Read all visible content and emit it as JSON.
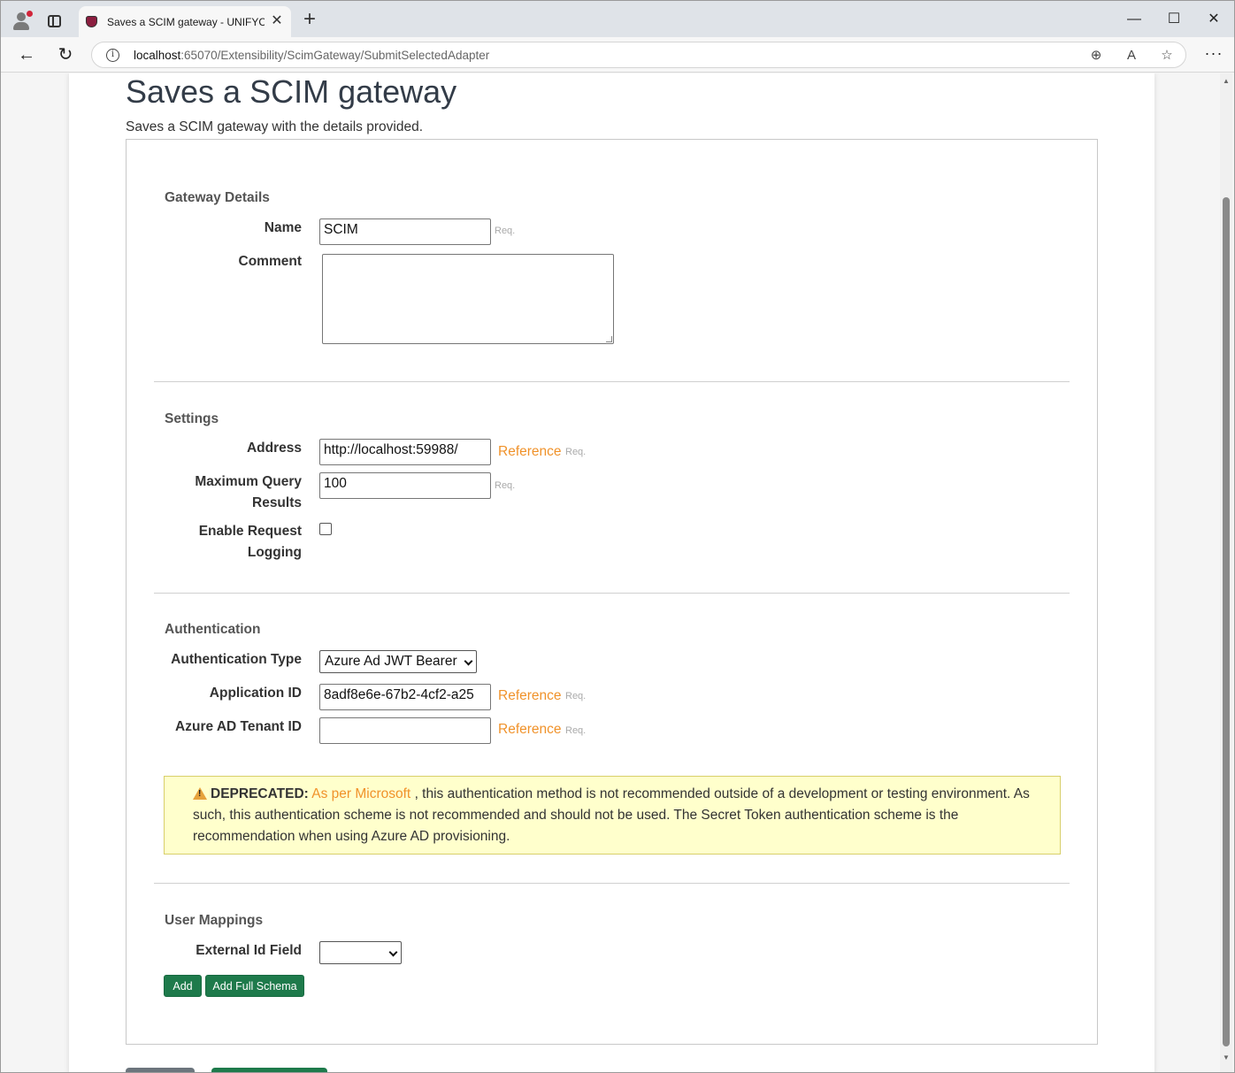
{
  "browser": {
    "tab_title": "Saves a SCIM gateway - UNIFYConnect",
    "tab_close": "✕",
    "new_tab": "+",
    "url_host": "localhost",
    "url_rest": ":65070/Extensibility/ScimGateway/SubmitSelectedAdapter",
    "minimize": "—",
    "maximize": "☐",
    "close": "✕",
    "back": "←",
    "refresh": "↻",
    "menu": "···"
  },
  "page": {
    "title": "Saves a SCIM gateway",
    "subtitle": "Saves a SCIM gateway with the details provided."
  },
  "gateway_details": {
    "section_title": "Gateway Details",
    "name_label": "Name",
    "name_value": "SCIM",
    "name_req": "Req.",
    "comment_label": "Comment"
  },
  "settings": {
    "section_title": "Settings",
    "address_label": "Address",
    "address_value": "http://localhost:59988/",
    "address_ref": "Reference",
    "address_req": "Req.",
    "max_query_label_1": "Maximum Query",
    "max_query_label_2": "Results",
    "max_query_value": "100",
    "max_query_req": "Req.",
    "logging_label_1": "Enable Request",
    "logging_label_2": "Logging",
    "logging_enabled": false
  },
  "authentication": {
    "section_title": "Authentication",
    "auth_type_label": "Authentication Type",
    "auth_type_value": "Azure Ad JWT Bearer",
    "app_id_label": "Application ID",
    "app_id_value": "8adf8e6e-67b2-4cf2-a25",
    "app_id_ref": "Reference",
    "app_id_req": "Req.",
    "tenant_label": "Azure AD Tenant ID",
    "tenant_value": "",
    "tenant_ref": "Reference",
    "tenant_req": "Req.",
    "warning_title": "DEPRECATED:",
    "warning_link": "As per Microsoft",
    "warning_text": ", this authentication method is not recommended outside of a development or testing environment. As such, this authentication scheme is not recommended and should not be used. The Secret Token authentication scheme is the recommendation when using Azure AD provisioning."
  },
  "user_mappings": {
    "section_title": "User Mappings",
    "external_id_label": "External Id Field",
    "external_id_value": "",
    "add_label": "Add",
    "add_full_schema_label": "Add Full Schema"
  },
  "colors": {
    "accent_link": "#f0922a",
    "button_green": "#1e7a4b",
    "warning_bg": "#ffffcc"
  }
}
